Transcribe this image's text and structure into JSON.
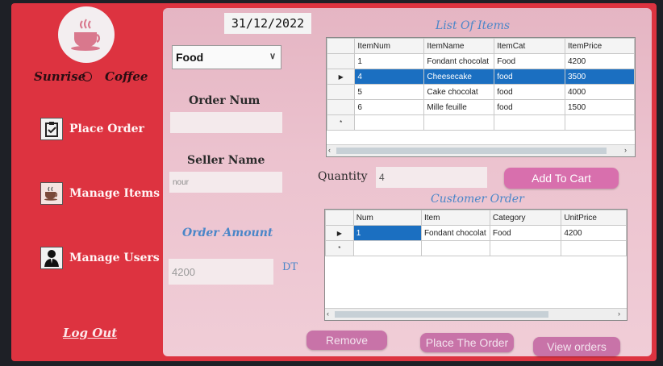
{
  "brand": {
    "left": "Sunrise",
    "right": "Coffee"
  },
  "nav": {
    "place_order": "Place Order",
    "manage_items": "Manage Items",
    "manage_users": "Manage Users",
    "logout": "Log Out"
  },
  "date": "31/12/2022",
  "category_select": {
    "value": "Food"
  },
  "order_num": {
    "label": "Order Num",
    "value": ""
  },
  "seller_name": {
    "label": "Seller Name",
    "value": "nour"
  },
  "order_amount": {
    "label": "Order Amount",
    "value": "4200",
    "currency": "DT"
  },
  "list_title": "List Of Items",
  "items_table": {
    "headers": [
      "ItemNum",
      "ItemName",
      "ItemCat",
      "ItemPrice"
    ],
    "rows": [
      [
        "1",
        "Fondant chocolat",
        "Food",
        "4200"
      ],
      [
        "4",
        "Cheesecake",
        "food",
        "3500"
      ],
      [
        "5",
        "Cake chocolat",
        "food",
        "4000"
      ],
      [
        "6",
        "Mille feuille",
        "food",
        "1500"
      ]
    ]
  },
  "quantity": {
    "label": "Quantity",
    "value": "4"
  },
  "add_to_cart": "Add To Cart",
  "order_title": "Customer Order",
  "order_table": {
    "headers": [
      "Num",
      "Item",
      "Category",
      "UnitPrice"
    ],
    "rows": [
      [
        "1",
        "Fondant chocolat",
        "Food",
        "4200"
      ]
    ]
  },
  "buttons": {
    "remove": "Remove",
    "place_order": "Place The Order",
    "view_orders": "View orders"
  },
  "colors": {
    "sidebar": "#dd3340",
    "panel": "#ecc3cf",
    "accent_blue": "#4a86c8",
    "button": "#d86fad",
    "selection": "#1b6fc1"
  }
}
